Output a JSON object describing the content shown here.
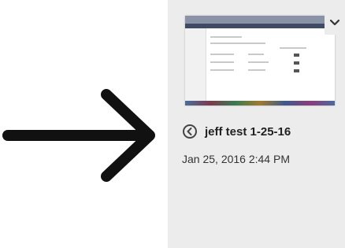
{
  "card": {
    "title": "jeff test 1-25-16",
    "timestamp": "Jan 25, 2016 2:44 PM"
  },
  "icons": {
    "back": "circle-left-arrow-icon",
    "menu": "chevron-down-icon",
    "annotation": "arrow-right-icon"
  },
  "colors": {
    "panel_bg": "#ececec",
    "arrow": "#111111",
    "text": "#222222"
  }
}
